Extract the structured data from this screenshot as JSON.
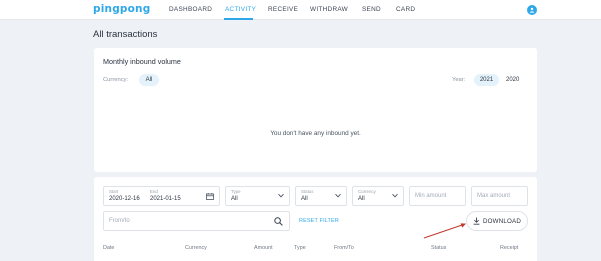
{
  "nav": {
    "logo": "pingpong",
    "items": [
      {
        "label": "DASHBOARD"
      },
      {
        "label": "ACTIVITY"
      },
      {
        "label": "RECEIVE"
      },
      {
        "label": "WITHDRAW"
      },
      {
        "label": "SEND"
      },
      {
        "label": "CARD"
      }
    ],
    "active_index": 1,
    "user_icon": "user-avatar-icon"
  },
  "page": {
    "title": "All transactions"
  },
  "inbound": {
    "title": "Monthly inbound volume",
    "currency_label": "Currency:",
    "currency_value": "All",
    "year_label": "Year:",
    "years": [
      "2021",
      "2020"
    ],
    "selected_year": "2021",
    "empty_message": "You don't have any inbound yet."
  },
  "filters": {
    "start_label": "Start",
    "start_value": "2020-12-16",
    "end_label": "End",
    "end_value": "2021-01-15",
    "type_label": "Type",
    "type_value": "All",
    "status_label": "Status",
    "status_value": "All",
    "currency_label": "Currency",
    "currency_value": "All",
    "min_amount_placeholder": "Min amount",
    "max_amount_placeholder": "Max amount",
    "search_placeholder": "From/to",
    "reset_label": "RESET FILTER",
    "download_label": "DOWNLOAD"
  },
  "table": {
    "columns": [
      "Date",
      "Currency",
      "Amount",
      "Type",
      "From/To",
      "Status",
      "Receipt"
    ]
  },
  "colors": {
    "accent": "#2ea8e8",
    "background": "#eef1f5",
    "annotation_arrow": "#c0392b"
  }
}
